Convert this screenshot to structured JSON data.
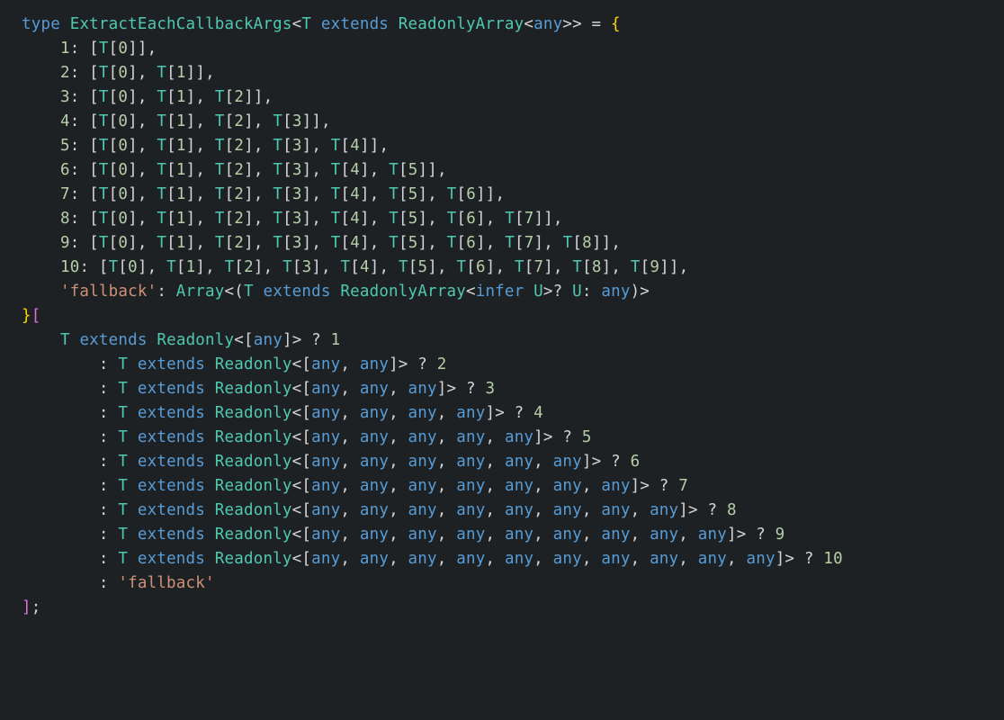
{
  "code": {
    "typeName": "ExtractEachCallbackArgs",
    "paramName": "T",
    "extendsType": "ReadonlyArray",
    "anyKw": "any",
    "typeKw": "type",
    "extendsKw": "extends",
    "inferKw": "infer",
    "readonlyType": "Readonly",
    "arrayType": "Array",
    "uType": "U",
    "fallbackKey": "'fallback'",
    "fallbackStr": "'fallback'",
    "cases": [
      {
        "key": "1",
        "tuple": [
          "T[0]"
        ]
      },
      {
        "key": "2",
        "tuple": [
          "T[0]",
          "T[1]"
        ]
      },
      {
        "key": "3",
        "tuple": [
          "T[0]",
          "T[1]",
          "T[2]"
        ]
      },
      {
        "key": "4",
        "tuple": [
          "T[0]",
          "T[1]",
          "T[2]",
          "T[3]"
        ]
      },
      {
        "key": "5",
        "tuple": [
          "T[0]",
          "T[1]",
          "T[2]",
          "T[3]",
          "T[4]"
        ]
      },
      {
        "key": "6",
        "tuple": [
          "T[0]",
          "T[1]",
          "T[2]",
          "T[3]",
          "T[4]",
          "T[5]"
        ]
      },
      {
        "key": "7",
        "tuple": [
          "T[0]",
          "T[1]",
          "T[2]",
          "T[3]",
          "T[4]",
          "T[5]",
          "T[6]"
        ]
      },
      {
        "key": "8",
        "tuple": [
          "T[0]",
          "T[1]",
          "T[2]",
          "T[3]",
          "T[4]",
          "T[5]",
          "T[6]",
          "T[7]"
        ]
      },
      {
        "key": "9",
        "tuple": [
          "T[0]",
          "T[1]",
          "T[2]",
          "T[3]",
          "T[4]",
          "T[5]",
          "T[6]",
          "T[7]",
          "T[8]"
        ]
      },
      {
        "key": "10",
        "tuple": [
          "T[0]",
          "T[1]",
          "T[2]",
          "T[3]",
          "T[4]",
          "T[5]",
          "T[6]",
          "T[7]",
          "T[8]",
          "T[9]"
        ]
      }
    ],
    "conditions": [
      {
        "arity": 1,
        "result": "1"
      },
      {
        "arity": 2,
        "result": "2"
      },
      {
        "arity": 3,
        "result": "3"
      },
      {
        "arity": 4,
        "result": "4"
      },
      {
        "arity": 5,
        "result": "5"
      },
      {
        "arity": 6,
        "result": "6"
      },
      {
        "arity": 7,
        "result": "7"
      },
      {
        "arity": 8,
        "result": "8"
      },
      {
        "arity": 9,
        "result": "9"
      },
      {
        "arity": 10,
        "result": "10"
      }
    ]
  }
}
